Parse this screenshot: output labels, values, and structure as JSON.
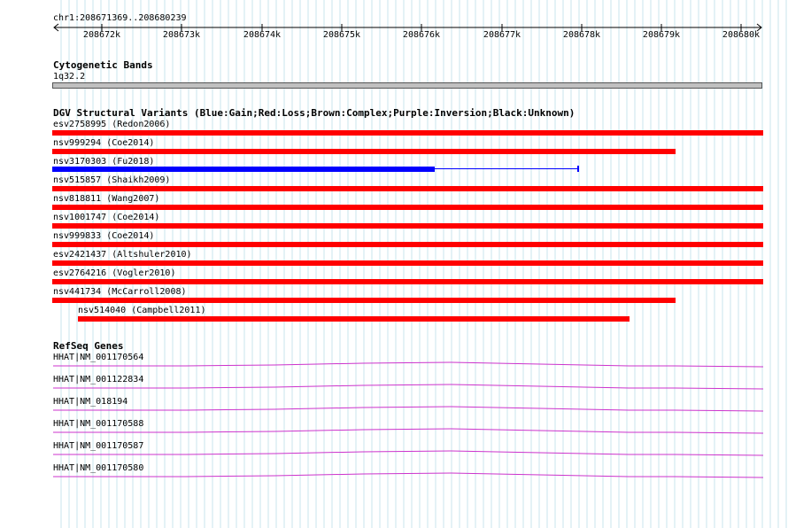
{
  "ruler": {
    "coordinate_label": "chr1:208671369..208680239",
    "ticks": [
      "208672k",
      "208673k",
      "208674k",
      "208675k",
      "208676k",
      "208677k",
      "208678k",
      "208679k",
      "208680k"
    ]
  },
  "cytoband": {
    "title": "Cytogenetic Bands",
    "band_name": "1q32.2",
    "band_color": "#c0c0c0"
  },
  "dgv": {
    "title": "DGV Structural Variants (Blue:Gain;Red:Loss;Brown:Complex;Purple:Inversion;Black:Unknown)",
    "colors": {
      "loss": "#ff0000",
      "gain": "#0000ff"
    },
    "variants": [
      {
        "label": "esv2758995 (Redon2006)",
        "type": "loss"
      },
      {
        "label": "nsv999294 (Coe2014)",
        "type": "loss"
      },
      {
        "label": "nsv3170303 (Fu2018)",
        "type": "gain"
      },
      {
        "label": "nsv515857 (Shaikh2009)",
        "type": "loss"
      },
      {
        "label": "nsv818811 (Wang2007)",
        "type": "loss"
      },
      {
        "label": "nsv1001747 (Coe2014)",
        "type": "loss"
      },
      {
        "label": "nsv999833 (Coe2014)",
        "type": "loss"
      },
      {
        "label": "esv2421437 (Altshuler2010)",
        "type": "loss"
      },
      {
        "label": "esv2764216 (Vogler2010)",
        "type": "loss"
      },
      {
        "label": "nsv441734 (McCarroll2008)",
        "type": "loss"
      },
      {
        "label": "nsv514040 (Campbell2011)",
        "type": "loss"
      }
    ]
  },
  "refseq": {
    "title": "RefSeq Genes",
    "color": "#cc33cc",
    "genes": [
      {
        "label": "HHAT|NM_001170564"
      },
      {
        "label": "HHAT|NM_001122834"
      },
      {
        "label": "HHAT|NM_018194"
      },
      {
        "label": "HHAT|NM_001170588"
      },
      {
        "label": "HHAT|NM_001170587"
      },
      {
        "label": "HHAT|NM_001170580"
      }
    ]
  },
  "grid_color": "#c8e4ec"
}
